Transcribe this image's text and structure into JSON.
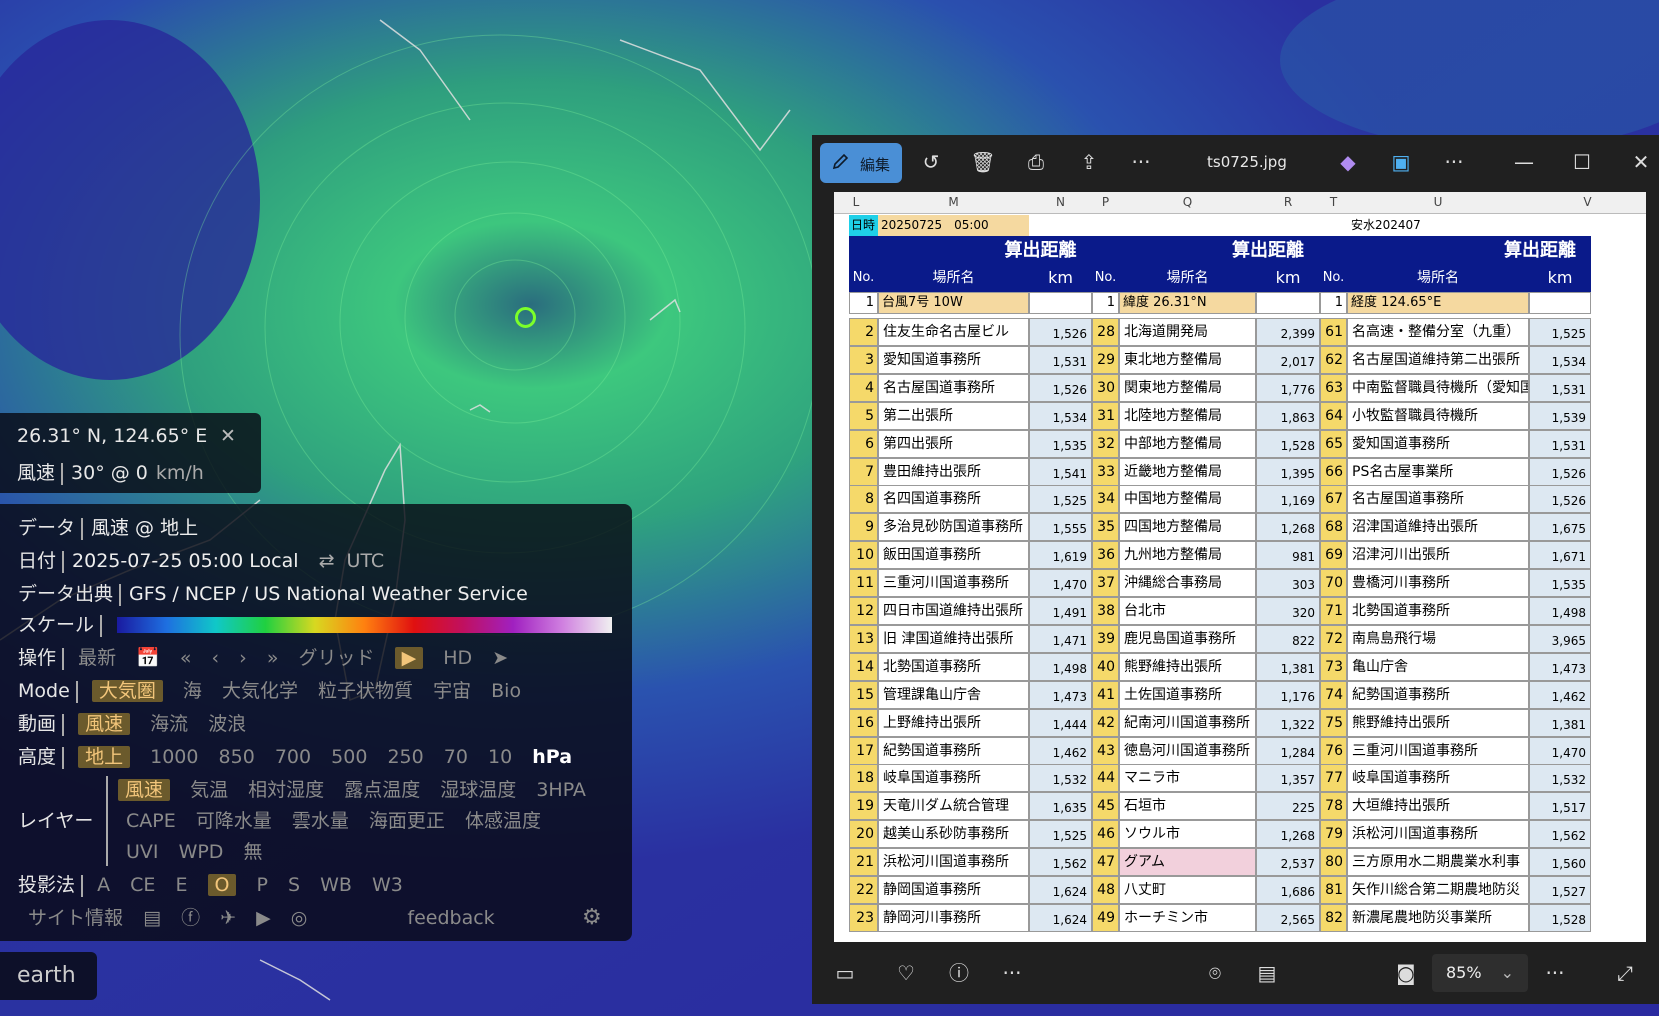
{
  "earth": {
    "info": {
      "coords": "26.31° N, 124.65° E",
      "close": "✕",
      "wind_label": "風速",
      "wind_value": "30° @ 0",
      "wind_unit": "km/h"
    },
    "panel": {
      "data_label": "データ",
      "data_value": "風速 @ 地上",
      "date_label": "日付",
      "date_value": "2025-07-25 05:00 Local",
      "date_swap": "⇄",
      "date_alt": "UTC",
      "source_label": "データ出典",
      "source_value": "GFS / NCEP / US National Weather Service",
      "scale_label": "スケール",
      "ops_label": "操作",
      "ops": [
        "最新",
        "📅",
        "«",
        "‹",
        "›",
        "»",
        "グリッド",
        "▶",
        "HD",
        "➤"
      ],
      "mode_label": "Mode",
      "modes": [
        "大気圏",
        "海",
        "大気化学",
        "粒子状物質",
        "宇宙",
        "Bio"
      ],
      "mode_selected": "大気圏",
      "anim_label": "動画",
      "anims": [
        "風速",
        "海流",
        "波浪"
      ],
      "height_label": "高度",
      "heights": [
        "地上",
        "1000",
        "850",
        "700",
        "500",
        "250",
        "70",
        "10",
        "hPa"
      ],
      "layer_label": "レイヤー",
      "layers_row1": [
        "風速",
        "気温",
        "相対湿度",
        "露点温度",
        "湿球温度",
        "3HPA"
      ],
      "layers_row2": [
        "CAPE",
        "可降水量",
        "雲水量",
        "海面更正",
        "体感温度"
      ],
      "layers_row3": [
        "UVI",
        "WPD",
        "無"
      ],
      "proj_label": "投影法",
      "projs": [
        "A",
        "CE",
        "E",
        "O",
        "P",
        "S",
        "WB",
        "W3"
      ],
      "site_label": "サイト情報",
      "feedback": "feedback"
    },
    "earth_label": "earth"
  },
  "viewer": {
    "edit_label": "編集",
    "filename": "ts0725.jpg",
    "more": "···",
    "zoom": "85%",
    "sheet": {
      "col_letters": [
        "L",
        "M",
        "N",
        "P",
        "Q",
        "R",
        "T",
        "U",
        "V"
      ],
      "datetime_label": "日時",
      "datetime_value": "20250725　05:00",
      "set_label": "安水202407",
      "dist_header": "算出距離",
      "no_header": "No.",
      "place_header": "場所名",
      "km_header": "km",
      "row1": [
        {
          "no": "1",
          "place": "台風7号 10W"
        },
        {
          "no": "1",
          "place": "緯度 26.31°N"
        },
        {
          "no": "1",
          "place": "経度 124.65°E"
        }
      ],
      "groupA": [
        [
          "2",
          "住友生命名古屋ビル",
          "1,526"
        ],
        [
          "3",
          "愛知国道事務所",
          "1,531"
        ],
        [
          "4",
          "名古屋国道事務所",
          "1,526"
        ],
        [
          "5",
          "第二出張所",
          "1,534"
        ],
        [
          "6",
          "第四出張所",
          "1,535"
        ],
        [
          "7",
          "豊田維持出張所",
          "1,541"
        ],
        [
          "8",
          "名四国道事務所",
          "1,525"
        ],
        [
          "9",
          "多治見砂防国道事務所",
          "1,555"
        ],
        [
          "10",
          "飯田国道事務所",
          "1,619"
        ],
        [
          "11",
          "三重河川国道事務所",
          "1,470"
        ],
        [
          "12",
          "四日市国道維持出張所",
          "1,491"
        ],
        [
          "13",
          "旧 津国道維持出張所",
          "1,471"
        ],
        [
          "14",
          "北勢国道事務所",
          "1,498"
        ],
        [
          "15",
          "管理課亀山庁舎",
          "1,473"
        ],
        [
          "16",
          "上野維持出張所",
          "1,444"
        ],
        [
          "17",
          "紀勢国道事務所",
          "1,462"
        ],
        [
          "18",
          "岐阜国道事務所",
          "1,532"
        ],
        [
          "19",
          "天竜川ダム統合管理",
          "1,635"
        ],
        [
          "20",
          "越美山系砂防事務所",
          "1,525"
        ],
        [
          "21",
          "浜松河川国道事務所",
          "1,562"
        ],
        [
          "22",
          "静岡国道事務所",
          "1,624"
        ],
        [
          "23",
          "静岡河川事務所",
          "1,624"
        ]
      ],
      "groupB": [
        [
          "28",
          "北海道開発局",
          "2,399"
        ],
        [
          "29",
          "東北地方整備局",
          "2,017"
        ],
        [
          "30",
          "関東地方整備局",
          "1,776"
        ],
        [
          "31",
          "北陸地方整備局",
          "1,863"
        ],
        [
          "32",
          "中部地方整備局",
          "1,528"
        ],
        [
          "33",
          "近畿地方整備局",
          "1,395"
        ],
        [
          "34",
          "中国地方整備局",
          "1,169"
        ],
        [
          "35",
          "四国地方整備局",
          "1,268"
        ],
        [
          "36",
          "九州地方整備局",
          "981"
        ],
        [
          "37",
          "沖縄総合事務局",
          "303"
        ],
        [
          "38",
          "台北市",
          "320"
        ],
        [
          "39",
          "鹿児島国道事務所",
          "822"
        ],
        [
          "40",
          "熊野維持出張所",
          "1,381"
        ],
        [
          "41",
          "土佐国道事務所",
          "1,176"
        ],
        [
          "42",
          "紀南河川国道事務所",
          "1,322"
        ],
        [
          "43",
          "徳島河川国道事務所",
          "1,284"
        ],
        [
          "44",
          "マニラ市",
          "1,357"
        ],
        [
          "45",
          "石垣市",
          "225"
        ],
        [
          "46",
          "ソウル市",
          "1,268"
        ],
        [
          "47",
          "グアム",
          "2,537"
        ],
        [
          "48",
          "八丈町",
          "1,686"
        ],
        [
          "49",
          "ホーチミン市",
          "2,565"
        ]
      ],
      "groupC": [
        [
          "61",
          "名高速・整備分室（九重）",
          "1,525"
        ],
        [
          "62",
          "名古屋国道維持第二出張所",
          "1,534"
        ],
        [
          "63",
          "中南監督職員待機所（愛知国",
          "1,531"
        ],
        [
          "64",
          "小牧監督職員待機所",
          "1,539"
        ],
        [
          "65",
          "愛知国道事務所",
          "1,531"
        ],
        [
          "66",
          "PS名古屋事業所",
          "1,526"
        ],
        [
          "67",
          "名古屋国道事務所",
          "1,526"
        ],
        [
          "68",
          "沼津国道維持出張所",
          "1,675"
        ],
        [
          "69",
          "沼津河川出張所",
          "1,671"
        ],
        [
          "70",
          "豊橋河川事務所",
          "1,535"
        ],
        [
          "71",
          "北勢国道事務所",
          "1,498"
        ],
        [
          "72",
          "南鳥島飛行場",
          "3,965"
        ],
        [
          "73",
          "亀山庁舎",
          "1,473"
        ],
        [
          "74",
          "紀勢国道事務所",
          "1,462"
        ],
        [
          "75",
          "熊野維持出張所",
          "1,381"
        ],
        [
          "76",
          "三重河川国道事務所",
          "1,470"
        ],
        [
          "77",
          "岐阜国道事務所",
          "1,532"
        ],
        [
          "78",
          "大垣維持出張所",
          "1,517"
        ],
        [
          "79",
          "浜松河川国道事務所",
          "1,562"
        ],
        [
          "80",
          "三方原用水二期農業水利事",
          "1,560"
        ],
        [
          "81",
          "矢作川総合第二期農地防災",
          "1,527"
        ],
        [
          "82",
          "新濃尾農地防災事業所",
          "1,528"
        ]
      ]
    }
  },
  "colors": {
    "accent": "#4a8fd6",
    "selected_bg": "#6b5a2c",
    "selected_fg": "#f2c57a",
    "sheet_header": "#0a1a8a",
    "row_num": "#f5d96a",
    "dist_cell": "#dde8f2",
    "highlight": "#f2d0dc",
    "ocean": "#2838a8",
    "wind": "#3fd37a"
  }
}
